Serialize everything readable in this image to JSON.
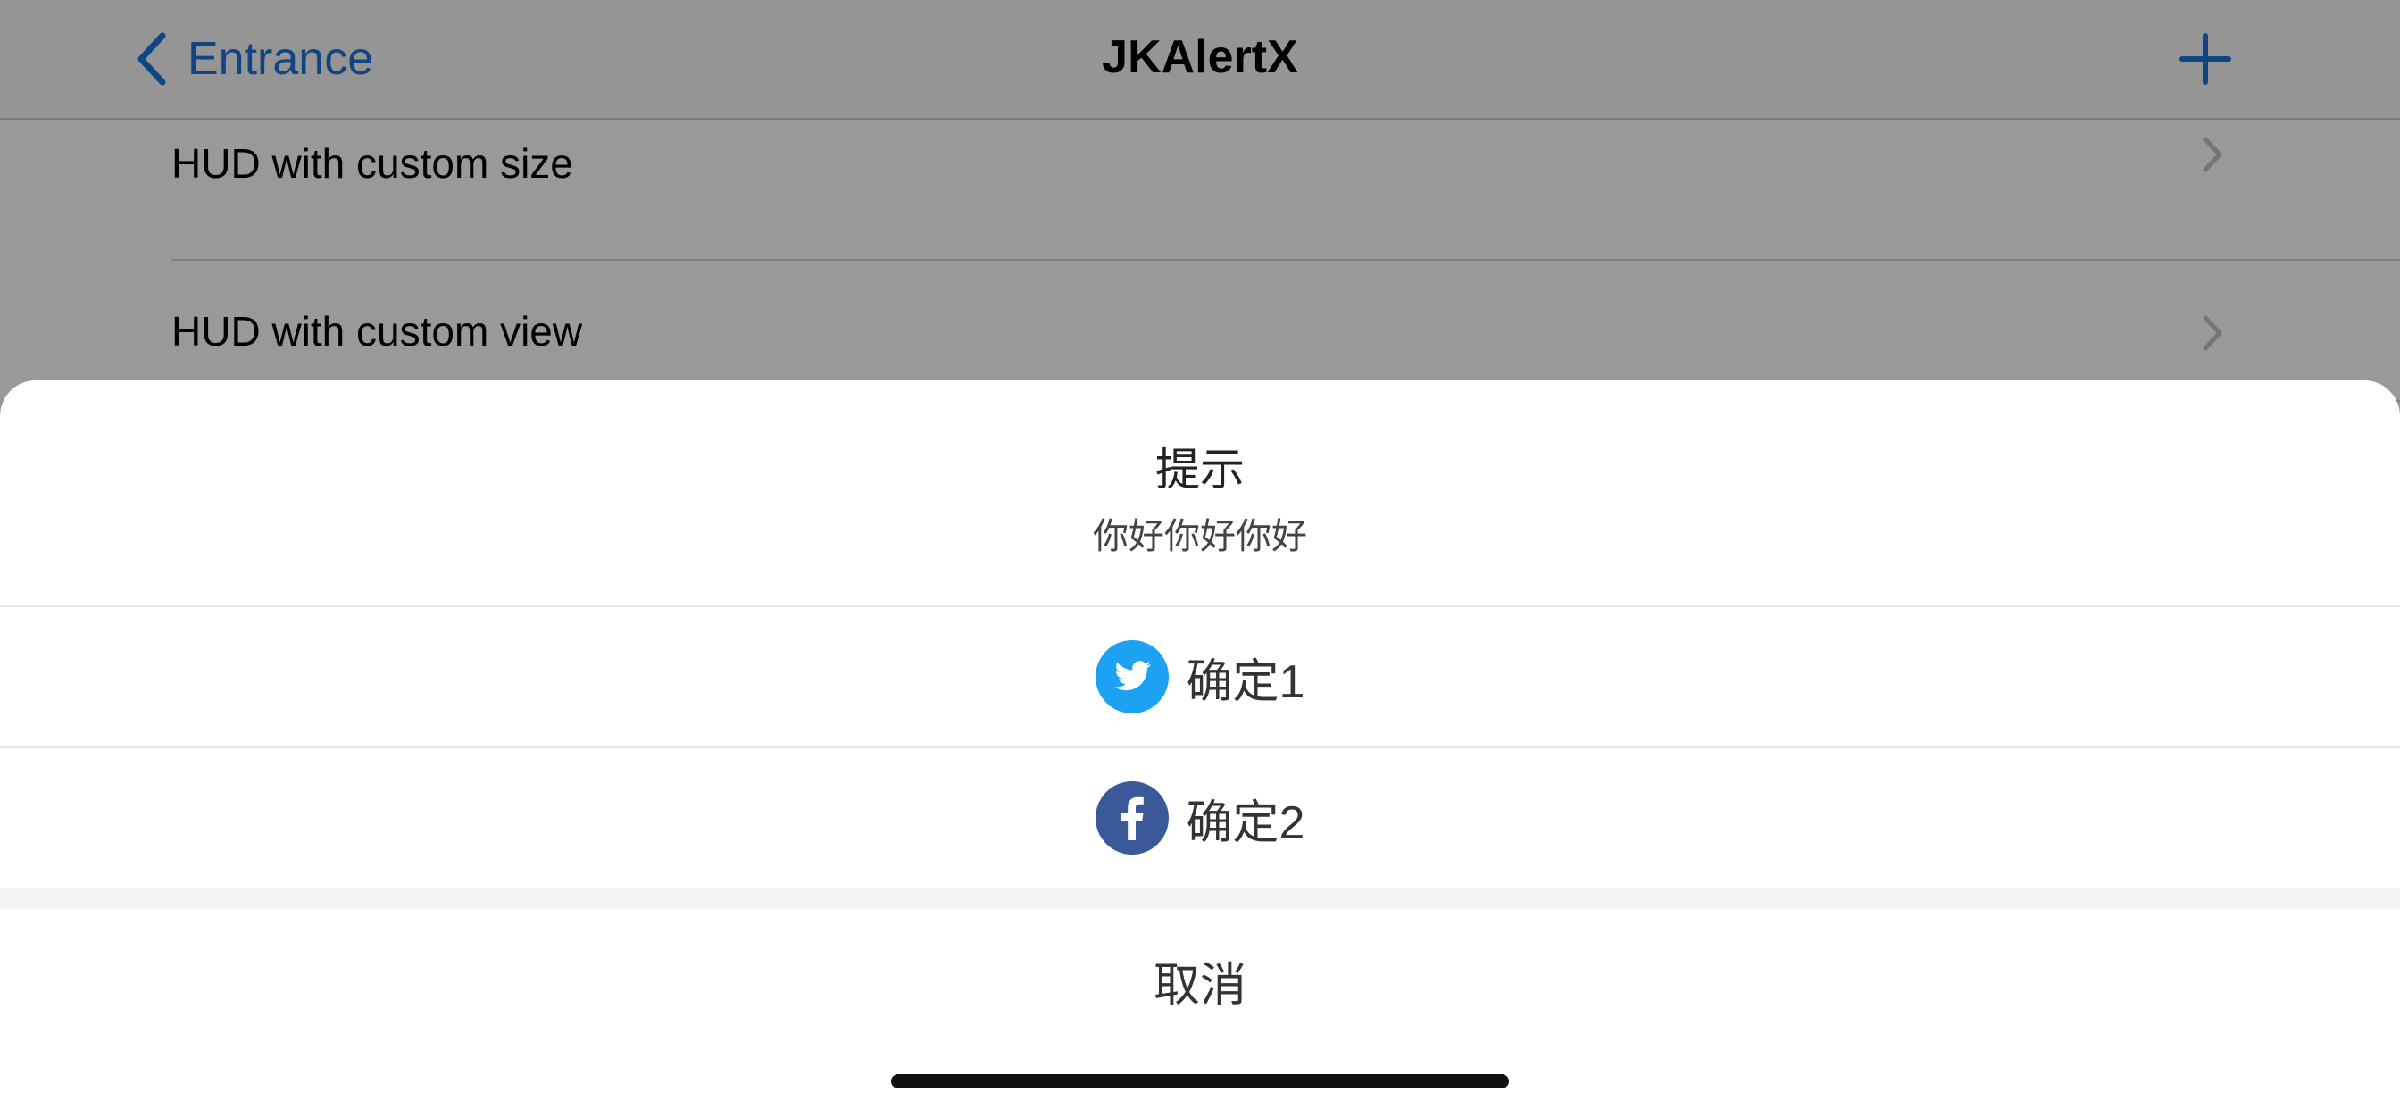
{
  "navbar": {
    "back_label": "Entrance",
    "title": "JKAlertX",
    "accent_color": "#1a73d9"
  },
  "table": {
    "rows": [
      {
        "label": "HUD with custom size"
      },
      {
        "label": "HUD with custom view"
      }
    ]
  },
  "sheet": {
    "title": "提示",
    "message": "你好你好你好",
    "actions": [
      {
        "label": "确定1",
        "icon": "twitter-icon",
        "icon_color": "#1da1f2"
      },
      {
        "label": "确定2",
        "icon": "facebook-icon",
        "icon_color": "#3b5998"
      }
    ],
    "cancel_label": "取消"
  }
}
